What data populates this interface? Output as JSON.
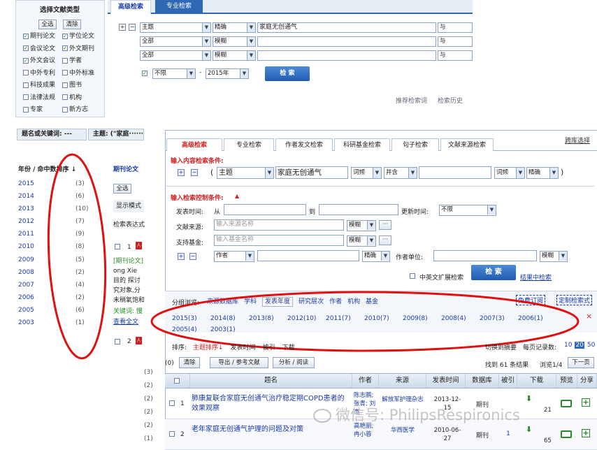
{
  "top_panel": {
    "doc_type_title": "选择文献类型",
    "select_all": "全选",
    "clear": "清除",
    "doc_types": [
      {
        "label": "期刊论文",
        "checked": true
      },
      {
        "label": "学位论文",
        "checked": true
      },
      {
        "label": "会议论文",
        "checked": true
      },
      {
        "label": "外文期刊",
        "checked": true
      },
      {
        "label": "外文会议",
        "checked": true
      },
      {
        "label": "学者",
        "checked": false
      },
      {
        "label": "中外专利",
        "checked": false
      },
      {
        "label": "中外标准",
        "checked": false
      },
      {
        "label": "科技成果",
        "checked": false
      },
      {
        "label": "图书",
        "checked": false
      },
      {
        "label": "法律法规",
        "checked": false
      },
      {
        "label": "机构",
        "checked": false
      },
      {
        "label": "专家",
        "checked": false
      },
      {
        "label": "新方志",
        "checked": false
      }
    ],
    "tabs": [
      "高级检索",
      "专业检索"
    ],
    "plus": "+",
    "minus": "−",
    "rows": [
      {
        "field": "主题",
        "match": "精确",
        "value": "家庭无创通气",
        "logic": "与"
      },
      {
        "field": "全部",
        "match": "模糊",
        "value": "",
        "logic": "与"
      },
      {
        "field": "全部",
        "match": "模糊",
        "value": "",
        "logic": "与"
      }
    ],
    "date_from": "不限",
    "date_sep": "-",
    "date_to": "2015年",
    "search_btn": "检 索",
    "link_recommend": "推荐检索词",
    "link_history": "检索历史"
  },
  "left_panel": {
    "header_a": "题名或关键词: ---",
    "header_b": "主题: (\"家庭·······",
    "year_header": "年份 / 命中数排序 ↓",
    "years": [
      {
        "year": "2015",
        "count": "(3)"
      },
      {
        "year": "2014",
        "count": "(6)"
      },
      {
        "year": "2013",
        "count": "(10)"
      },
      {
        "year": "2012",
        "count": "(7)"
      },
      {
        "year": "2011",
        "count": "(9)"
      },
      {
        "year": "2010",
        "count": "(8)"
      },
      {
        "year": "2009",
        "count": "(5)"
      },
      {
        "year": "2008",
        "count": "(2)"
      },
      {
        "year": "2007",
        "count": "(4)"
      },
      {
        "year": "2006",
        "count": "(2)"
      },
      {
        "year": "2005",
        "count": "(6)"
      },
      {
        "year": "2003",
        "count": "(1)"
      }
    ],
    "mid_title": "期刊论文",
    "mid_selectall": "全选",
    "mid_display": "显示模式",
    "mid_summary": "检索表达式",
    "item_num": "1",
    "item_source": "[期刊论文]",
    "item_lines": [
      "ong  Xie",
      "目的  探讨",
      "究对象,分",
      "末稍氧饱和"
    ],
    "item_kw": "关键词: 慢",
    "item_view": "查看全文",
    "item2_num": "2",
    "side_counts": [
      "(3)",
      "(2)",
      "(2)",
      "(2)",
      "(2)",
      "(1)"
    ]
  },
  "main_panel": {
    "cross_search": "跨库选择",
    "tabs": [
      "高级检索",
      "专业检索",
      "作者发文检索",
      "科研基金检索",
      "句子检索",
      "文献来源检索"
    ],
    "content_label": "输入内容检索条件:",
    "row_field": "主题",
    "row_value": "家庭无创通气",
    "row_freq": "词频",
    "row_logic": "并含",
    "row_freq2": "词频",
    "row_match": "精确",
    "paren_open": "(",
    "paren_close": ")",
    "control_label": "输入检索控制条件:",
    "pub_time": "发表时间:",
    "from": "从",
    "to": "到",
    "update_time": "更新时间:",
    "update_val": "不限",
    "source_label": "文献来源:",
    "source_ph": "输入来源名称",
    "source_match": "模糊",
    "fund_label": "支持基金:",
    "fund_ph": "输入基金名称",
    "fund_match": "模糊",
    "author_field": "作者",
    "author_match": "精确",
    "org_label": "作者单位:",
    "org_match": "模糊",
    "ellipsis": "···",
    "ext_label": "中英文扩展检索",
    "search_btn": "检 索",
    "search_in": "结果中检索",
    "group_label": "分组浏览:",
    "group_items": [
      "来源数据库",
      "学科",
      "发表年度",
      "研究层次",
      "作者",
      "机构",
      "基金"
    ],
    "free_order": "免费订阅",
    "custom": "定制检索式",
    "year_bar": [
      "2015(3)",
      "2014(8)",
      "2013(8)",
      "2012(10)",
      "2011(7)",
      "2010(7)",
      "2009(8)",
      "2008(4)",
      "2007(3)",
      "2006(1)",
      "2005(4)",
      "2003(1)"
    ],
    "close_x": "×",
    "sort_label": "排序:",
    "sort_items": [
      "主题排序↓",
      "发表时间",
      "被引",
      "下载"
    ],
    "switch_summary": "切换到摘要",
    "per_page": "每页记录数:",
    "per_opts": [
      "10",
      "20",
      "50"
    ],
    "sel_count": "(0)",
    "clear": "清除",
    "export": "导出 / 参考文献",
    "analyze": "分析 / 阅读",
    "found": "找到 61 条结果",
    "page_info": "浏览1/4",
    "next": "下一页",
    "cols": [
      "",
      "题名",
      "作者",
      "来源",
      "发表时间",
      "数据库",
      "被引",
      "下载",
      "预览",
      "分享"
    ],
    "rows": [
      {
        "num": "1",
        "title": "肺康复联合家庭无创通气治疗稳定期COPD患者的效果观察",
        "author": "陈志鹏; 张青; 刘杰",
        "source": "解放军护理杂志",
        "date": "2013-12-15",
        "db": "期刊",
        "cited": "",
        "dl": "21"
      },
      {
        "num": "2",
        "title": "老年家庭无创通气护理的问题及对策",
        "author": "高艳丽; 冉小蓉",
        "source": "华西医学",
        "date": "2010-06-27",
        "db": "期刊",
        "cited": "1",
        "dl": "65"
      }
    ]
  },
  "watermark": "微信号: PhilipsRespironics",
  "colors": {
    "accent_red": "#cc1111",
    "link_blue": "#1a3aa8",
    "header_blue": "#2f68b5"
  }
}
